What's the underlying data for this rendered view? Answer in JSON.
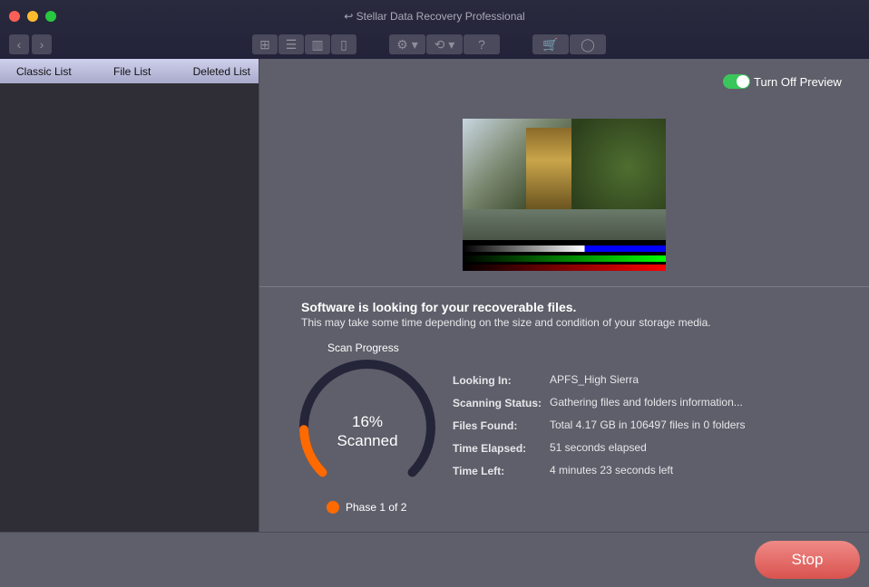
{
  "window": {
    "title": "Stellar Data Recovery Professional",
    "title_icon": "undo-arrow-icon"
  },
  "toolbar": {
    "back": "‹",
    "forward": "›",
    "help": "?"
  },
  "tabs": [
    "Classic List",
    "File List",
    "Deleted List"
  ],
  "preview": {
    "toggle_label": "Turn Off Preview",
    "toggle_on": true
  },
  "scan": {
    "heading": "Software is looking for your recoverable files.",
    "subheading": "This may take some time depending on the size and condition of your storage media.",
    "progress_title": "Scan Progress",
    "percent": "16%",
    "percent_value": 16,
    "scanned_label": "Scanned",
    "phase": "Phase 1 of 2",
    "details": [
      {
        "label": "Looking In:",
        "value": "APFS_High Sierra"
      },
      {
        "label": "Scanning Status:",
        "value": "Gathering files and folders information..."
      },
      {
        "label": "Files Found:",
        "value": "Total 4.17 GB in 106497 files in 0 folders"
      },
      {
        "label": "Time Elapsed:",
        "value": "51 seconds elapsed"
      },
      {
        "label": "Time Left:",
        "value": "4 minutes 23 seconds left"
      }
    ]
  },
  "stop_label": "Stop",
  "colors": {
    "accent": "#ff6a00",
    "toggle": "#3bc65b",
    "stop": "#e0605b",
    "track": "#25253a"
  }
}
